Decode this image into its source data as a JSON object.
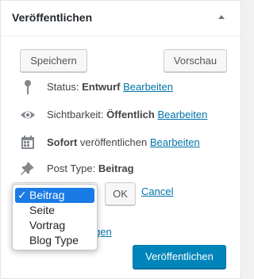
{
  "panel": {
    "title": "Veröffentlichen"
  },
  "toolbar": {
    "save_label": "Speichern",
    "preview_label": "Vorschau"
  },
  "status": {
    "label": "Status:",
    "value": "Entwurf",
    "edit": "Bearbeiten"
  },
  "visibility": {
    "label": "Sichtbarkeit:",
    "value": "Öffentlich",
    "edit": "Bearbeiten"
  },
  "schedule": {
    "value": "Sofort",
    "label": "veröffentlichen",
    "edit": "Bearbeiten"
  },
  "post_type": {
    "label": "Post Type:",
    "value": "Beitrag",
    "check_mark": "✓",
    "options": [
      "Beitrag",
      "Seite",
      "Vortrag",
      "Blog Type"
    ],
    "ok_label": "OK",
    "cancel_label": "Cancel"
  },
  "partial_link": "gen",
  "publish_label": "Veröffentlichen",
  "colors": {
    "accent": "#0085ba",
    "link": "#0073aa",
    "selection": "#1a7ae6"
  }
}
